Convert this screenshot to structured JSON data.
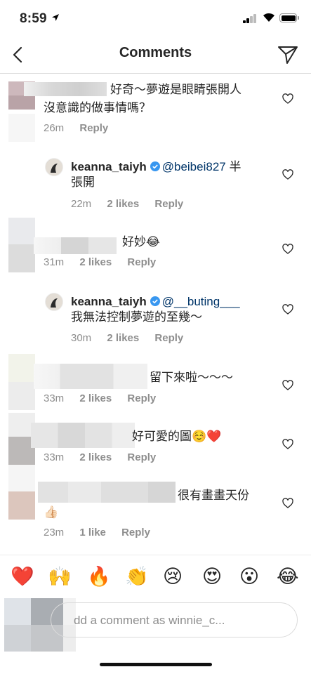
{
  "status": {
    "time": "8:59"
  },
  "header": {
    "title": "Comments"
  },
  "comments": [
    {
      "text_line1": "好奇～夢遊是眼睛張開人",
      "text_line2": "沒意識的做事情嗎？",
      "time": "26m",
      "reply": "Reply"
    },
    {
      "user": "keanna_taiyh",
      "mention": "@beibei827",
      "text_line1_suffix": " 半",
      "text_line2": "張開",
      "time": "22m",
      "likes": "2 likes",
      "reply": "Reply"
    },
    {
      "text": "好妙😂",
      "time": "31m",
      "likes": "2 likes",
      "reply": "Reply"
    },
    {
      "user": "keanna_taiyh",
      "mention": "@__buting___",
      "text_line2": "我無法控制夢遊的至幾～",
      "time": "30m",
      "likes": "2 likes",
      "reply": "Reply"
    },
    {
      "text": "留下來啦～～～",
      "time": "33m",
      "likes": "2 likes",
      "reply": "Reply"
    },
    {
      "text": "好可愛的圖☺️❤️",
      "time": "33m",
      "likes": "2 likes",
      "reply": "Reply"
    },
    {
      "text_line1": "很有畫畫天份",
      "text_line2": "👍🏻",
      "time": "23m",
      "likes": "1 like",
      "reply": "Reply"
    }
  ],
  "emojis": [
    "❤️",
    "🙌",
    "🔥",
    "👏",
    "😢",
    "😍",
    "😮",
    "😂"
  ],
  "input": {
    "placeholder": "dd a comment as winnie_c..."
  },
  "colors": {
    "text": "#262626",
    "meta": "#8e8e8e",
    "mention": "#003569",
    "verified": "#3897f0",
    "heart": "#dc2743"
  }
}
